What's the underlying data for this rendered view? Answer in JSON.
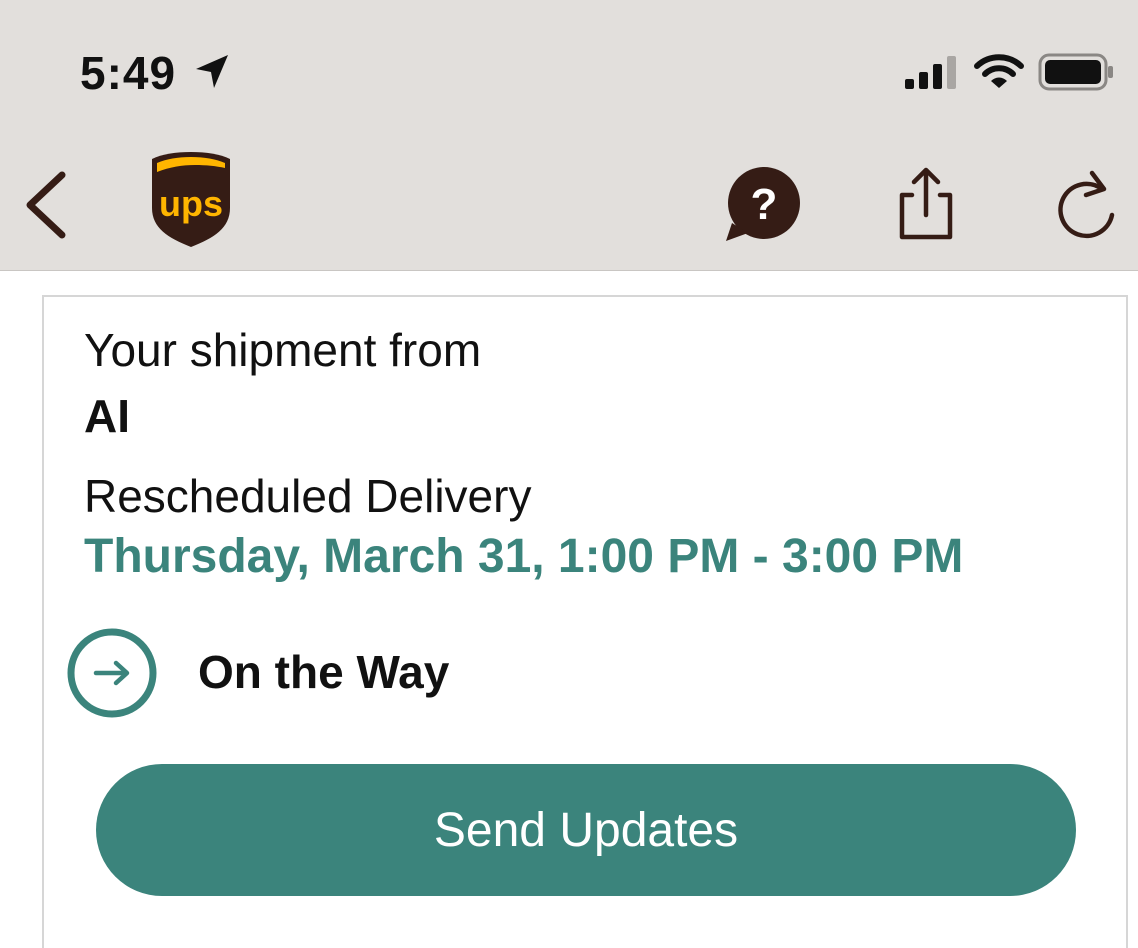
{
  "status_bar": {
    "time": "5:49",
    "icons": [
      "location-arrow-icon",
      "signal-icon",
      "wifi-icon",
      "battery-icon"
    ]
  },
  "nav_bar": {
    "logo_text": "ups",
    "icons": [
      "back-chevron-icon",
      "help-chat-icon",
      "share-icon",
      "refresh-icon"
    ]
  },
  "shipment": {
    "intro": "Your shipment from",
    "sender": "AI",
    "delivery_label": "Rescheduled Delivery",
    "delivery_window": "Thursday, March 31, 1:00 PM - 3:00 PM",
    "status": "On the Way",
    "status_icon": "arrow-right-circle-icon"
  },
  "actions": {
    "send_updates_label": "Send Updates"
  },
  "colors": {
    "accent": "#3b847c",
    "ups_brown": "#351c15",
    "ups_gold": "#ffb500",
    "nav_background": "#e2dfdc",
    "text": "#111111"
  }
}
